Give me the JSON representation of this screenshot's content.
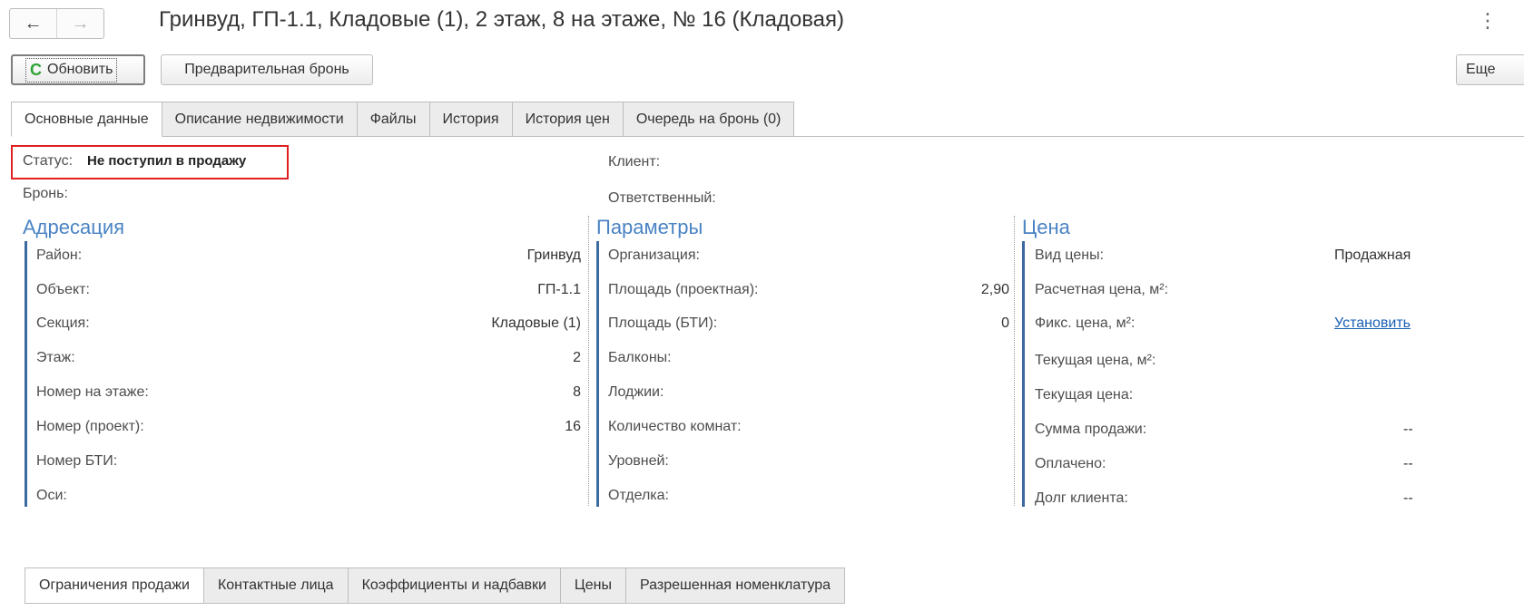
{
  "header": {
    "back_icon": "←",
    "forward_icon": "→",
    "title": "Гринвуд, ГП-1.1, Кладовые (1), 2 этаж, 8 на этаже, № 16 (Кладовая)",
    "more_icon": "⋮"
  },
  "toolbar": {
    "refresh_icon": "C",
    "refresh_label": "Обновить",
    "prebook_label": "Предварительная бронь",
    "more_label": "Еще"
  },
  "tabs": [
    {
      "label": "Основные данные"
    },
    {
      "label": "Описание недвижимости"
    },
    {
      "label": "Файлы"
    },
    {
      "label": "История"
    },
    {
      "label": "История цен"
    },
    {
      "label": "Очередь на бронь (0)"
    }
  ],
  "status": {
    "label": "Статус:",
    "value": "Не поступил в продажу"
  },
  "bron": {
    "label": "Бронь:"
  },
  "client": {
    "label": "Клиент:"
  },
  "responsible": {
    "label": "Ответственный:"
  },
  "address": {
    "title": "Адресация",
    "rows": [
      {
        "label": "Район:",
        "value": "Гринвуд"
      },
      {
        "label": "Объект:",
        "value": "ГП-1.1"
      },
      {
        "label": "Секция:",
        "value": "Кладовые (1)"
      },
      {
        "label": "Этаж:",
        "value": "2"
      },
      {
        "label": "Номер на этаже:",
        "value": "8"
      },
      {
        "label": "Номер (проект):",
        "value": "16"
      },
      {
        "label": "Номер БТИ:",
        "value": ""
      },
      {
        "label": "Оси:",
        "value": ""
      }
    ]
  },
  "params": {
    "title": "Параметры",
    "rows": [
      {
        "label": "Организация:",
        "value": ""
      },
      {
        "label": "Площадь (проектная):",
        "value": "2,90"
      },
      {
        "label": "Площадь (БТИ):",
        "value": "0"
      },
      {
        "label": "Балконы:",
        "value": ""
      },
      {
        "label": "Лоджии:",
        "value": ""
      },
      {
        "label": "Количество комнат:",
        "value": ""
      },
      {
        "label": "Уровней:",
        "value": ""
      },
      {
        "label": "Отделка:",
        "value": ""
      }
    ]
  },
  "price": {
    "title": "Цена",
    "rows": [
      {
        "label": "Вид цены:",
        "value": "Продажная"
      },
      {
        "label": "Расчетная цена, м²:",
        "value": ""
      },
      {
        "label": "Фикс. цена, м²:",
        "value": "Установить"
      },
      {
        "label": "Текущая цена, м²:",
        "value": ""
      },
      {
        "label": "Текущая цена:",
        "value": ""
      },
      {
        "label": "Сумма продажи:",
        "value": "--"
      },
      {
        "label": "Оплачено:",
        "value": "--"
      },
      {
        "label": "Долг клиента:",
        "value": "--"
      }
    ]
  },
  "bottom_tabs": [
    {
      "label": "Ограничения продажи"
    },
    {
      "label": "Контактные лица"
    },
    {
      "label": "Коэффициенты и надбавки"
    },
    {
      "label": "Цены"
    },
    {
      "label": "Разрешенная номенклатура"
    }
  ]
}
